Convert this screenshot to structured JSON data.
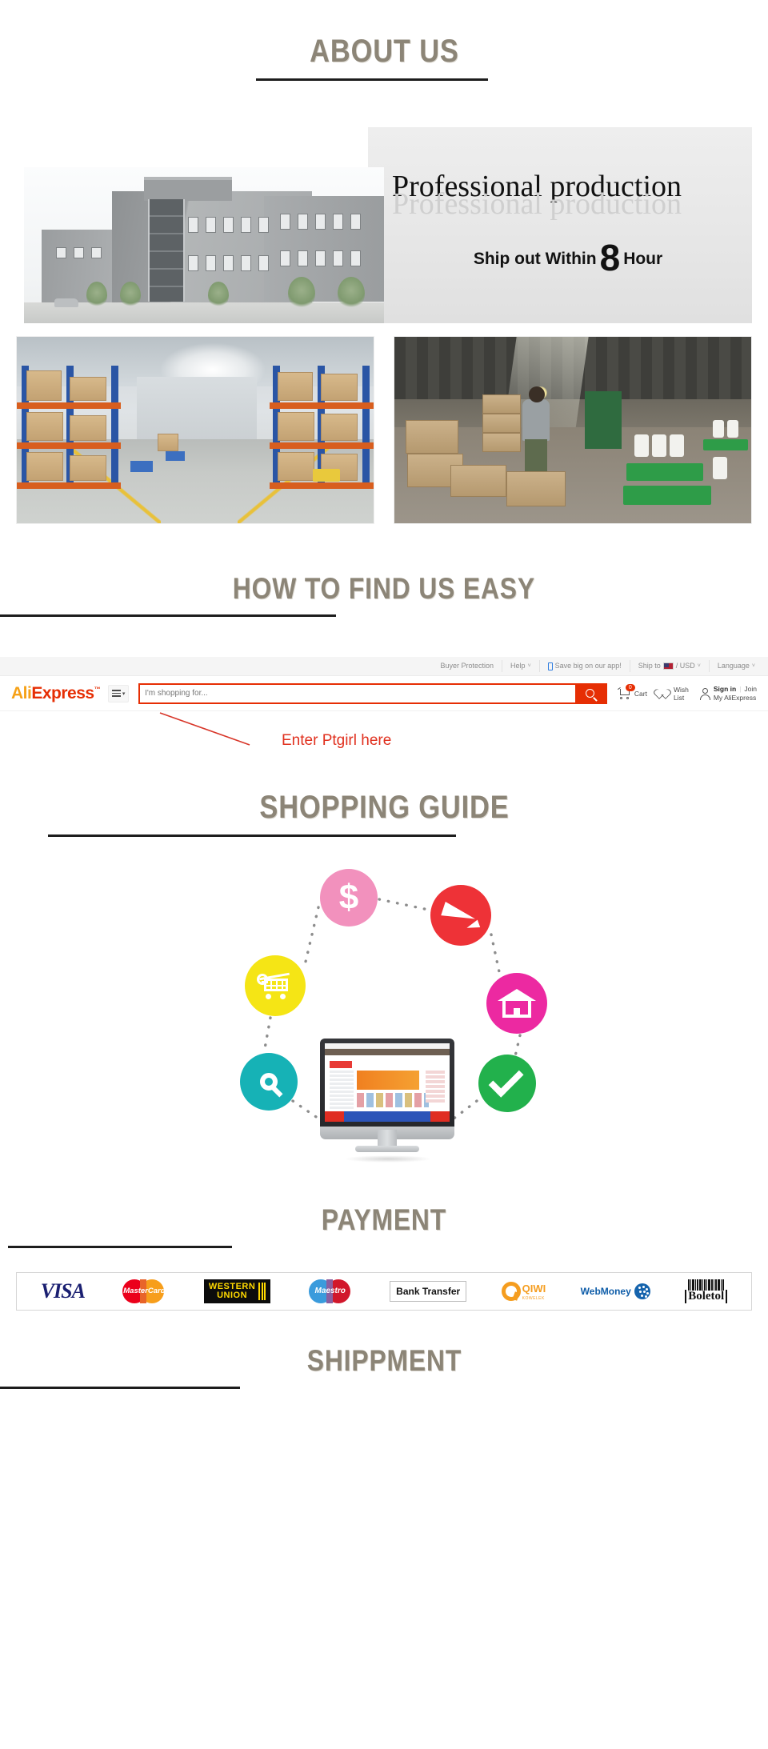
{
  "sections": {
    "about_us": "ABOUT US",
    "how_to_find": "HOW TO FIND US EASY",
    "shopping_guide": "SHOPPING GUIDE",
    "payment": "PAYMENT",
    "shippment": "SHIPPMENT"
  },
  "banner": {
    "headline": "Professional production",
    "headline_reflection": "Professional production",
    "sub_prefix": "Ship out Within",
    "sub_number": "8",
    "sub_suffix": "Hour"
  },
  "photos": {
    "building_alt": "factory-building-exterior",
    "warehouse_alt": "warehouse-aisle-with-pallet-racks",
    "packing_alt": "worker-packing-boxes-in-warehouse"
  },
  "aliexpress": {
    "topbar": [
      {
        "label": "Buyer Protection",
        "caret": "",
        "icon": ""
      },
      {
        "label": "Help",
        "caret": "˅",
        "icon": ""
      },
      {
        "label": "Save big on our app!",
        "caret": "",
        "icon": "phone-icon"
      },
      {
        "label_pre": "Ship to",
        "label_post": "/ USD",
        "caret": "˅",
        "icon": "us-flag-icon"
      },
      {
        "label": "Language",
        "caret": "˅",
        "icon": ""
      }
    ],
    "logo": {
      "ali": "Ali",
      "express": "Express",
      "tm": "™"
    },
    "burger_caret": "▾",
    "search": {
      "placeholder": "I'm shopping for...",
      "value": "",
      "button_icon": "search-icon",
      "button_color": "#e62e04"
    },
    "cart": {
      "label_top": "",
      "label": "Cart",
      "badge": "0",
      "icon": "cart-icon"
    },
    "wishlist": {
      "line1": "Wish",
      "line2": "List",
      "icon": "heart-icon"
    },
    "account": {
      "signin": "Sign in",
      "sep": "|",
      "join": "Join",
      "my": "My AliExpress",
      "icon": "user-icon"
    },
    "annotation": {
      "text": "Enter Ptgirl here",
      "color": "#e0301e"
    }
  },
  "guide_nodes": [
    {
      "name": "dollar",
      "icon": "dollar-icon",
      "color": "#f291bd"
    },
    {
      "name": "plane",
      "icon": "airplane-icon",
      "color": "#ee3237"
    },
    {
      "name": "house",
      "icon": "house-icon",
      "color": "#ec29a1"
    },
    {
      "name": "check",
      "icon": "checkmark-icon",
      "color": "#22b14c"
    },
    {
      "name": "search",
      "icon": "magnifier-icon",
      "color": "#16b2b6"
    },
    {
      "name": "cart",
      "icon": "add-to-cart-icon",
      "color": "#f5e515"
    }
  ],
  "payment_methods": [
    {
      "name": "visa",
      "label": "VISA"
    },
    {
      "name": "mastercard",
      "label": "MasterCard"
    },
    {
      "name": "western-union",
      "label_line1": "WESTERN",
      "label_line2": "UNION"
    },
    {
      "name": "maestro",
      "label": "Maestro"
    },
    {
      "name": "bank-transfer",
      "label": "Bank Transfer"
    },
    {
      "name": "qiwi",
      "label": "QIWI",
      "sub": "KOWELEK"
    },
    {
      "name": "webmoney",
      "label": "WebMoney"
    },
    {
      "name": "boleto",
      "label": "Boletol"
    }
  ],
  "colors": {
    "heading": "#8c8577",
    "rule": "#1d1d1d",
    "accent_red": "#e62e04",
    "annotation_red": "#e0301e"
  }
}
